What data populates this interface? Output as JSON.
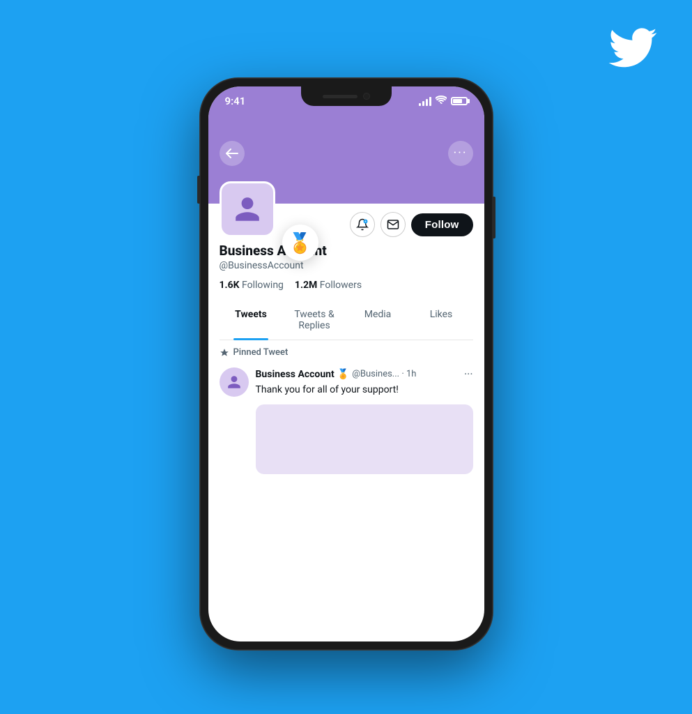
{
  "background_color": "#1DA1F2",
  "twitter_logo": "🐦",
  "phone": {
    "status_bar": {
      "time": "9:41",
      "signal": true,
      "wifi": true,
      "battery": true
    },
    "header": {
      "background_color": "#9b7fd4",
      "back_button": "←",
      "more_button": "•••"
    },
    "profile": {
      "name": "Business Account",
      "handle": "@BusinessAccount",
      "following_count": "1.6K",
      "following_label": "Following",
      "followers_count": "1.2M",
      "followers_label": "Followers",
      "verified": true,
      "verified_emoji": "🏅"
    },
    "action_buttons": {
      "notifications_icon": "🔔",
      "message_icon": "✉",
      "follow_label": "Follow"
    },
    "tabs": [
      {
        "id": "tweets",
        "label": "Tweets",
        "active": true
      },
      {
        "id": "tweets-replies",
        "label": "Tweets & Replies",
        "active": false
      },
      {
        "id": "media",
        "label": "Media",
        "active": false
      },
      {
        "id": "likes",
        "label": "Likes",
        "active": false
      }
    ],
    "pinned_tweet": {
      "pinned_label": "Pinned Tweet",
      "author_name": "Business Account",
      "author_handle": "@Busines...",
      "time": "1h",
      "verified": true,
      "text": "Thank you for all of your support!"
    }
  }
}
